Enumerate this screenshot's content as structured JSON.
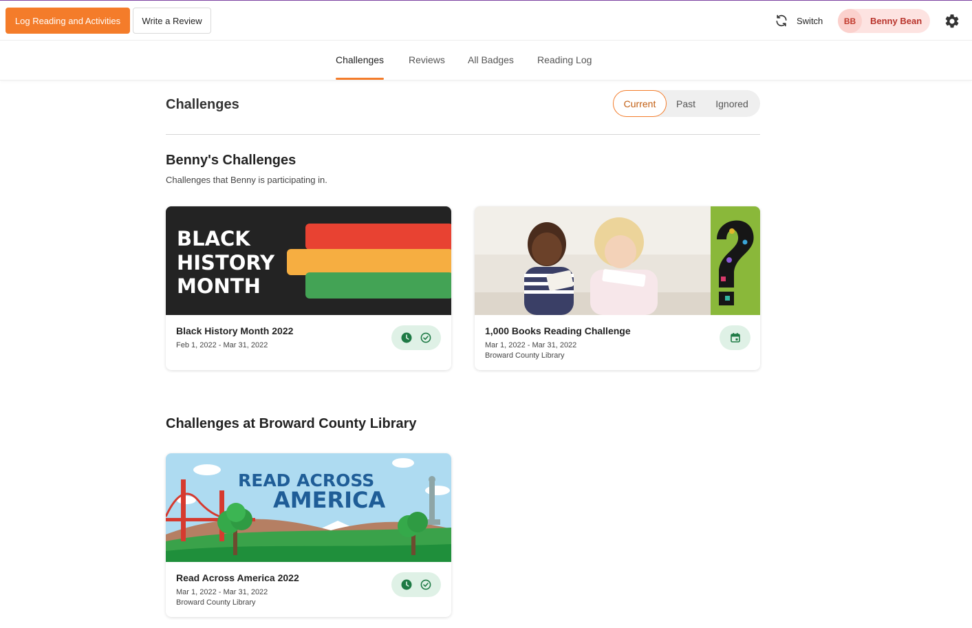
{
  "header": {
    "log_button": "Log Reading and Activities",
    "review_button": "Write a Review",
    "switch_label": "Switch",
    "user_initials": "BB",
    "user_name": "Benny Bean"
  },
  "tabs": [
    {
      "label": "Challenges",
      "active": true
    },
    {
      "label": "Reviews",
      "active": false
    },
    {
      "label": "All Badges",
      "active": false
    },
    {
      "label": "Reading Log",
      "active": false
    }
  ],
  "page": {
    "title": "Challenges",
    "filters": [
      {
        "label": "Current",
        "active": true
      },
      {
        "label": "Past",
        "active": false
      },
      {
        "label": "Ignored",
        "active": false
      }
    ]
  },
  "my_challenges": {
    "title": "Benny's Challenges",
    "subtitle": "Challenges that Benny is participating in.",
    "cards": [
      {
        "title": "Black History Month 2022",
        "dates": "Feb 1, 2022 - Mar 31, 2022",
        "library": "",
        "image_text": [
          "BLACK",
          "HISTORY",
          "MONTH"
        ],
        "status_icons": [
          "clock-icon",
          "check-circle-icon"
        ]
      },
      {
        "title": "1,000 Books Reading Challenge",
        "dates": "Mar 1, 2022 - Mar 31, 2022",
        "library": "Broward County Library",
        "status_icons": [
          "calendar-icon"
        ]
      }
    ]
  },
  "library_challenges": {
    "title": "Challenges at Broward County Library",
    "cards": [
      {
        "title": "Read Across America 2022",
        "dates": "Mar 1, 2022 - Mar 31, 2022",
        "library": "Broward County Library",
        "image_text": [
          "READ ACROSS",
          "AMERICA"
        ],
        "status_icons": [
          "clock-icon",
          "check-circle-icon"
        ]
      }
    ]
  },
  "colors": {
    "accent": "#f47c2a",
    "badge_bg": "#dff1e6",
    "badge_icon": "#1e7a45",
    "user_pill": "#fde3e1"
  }
}
